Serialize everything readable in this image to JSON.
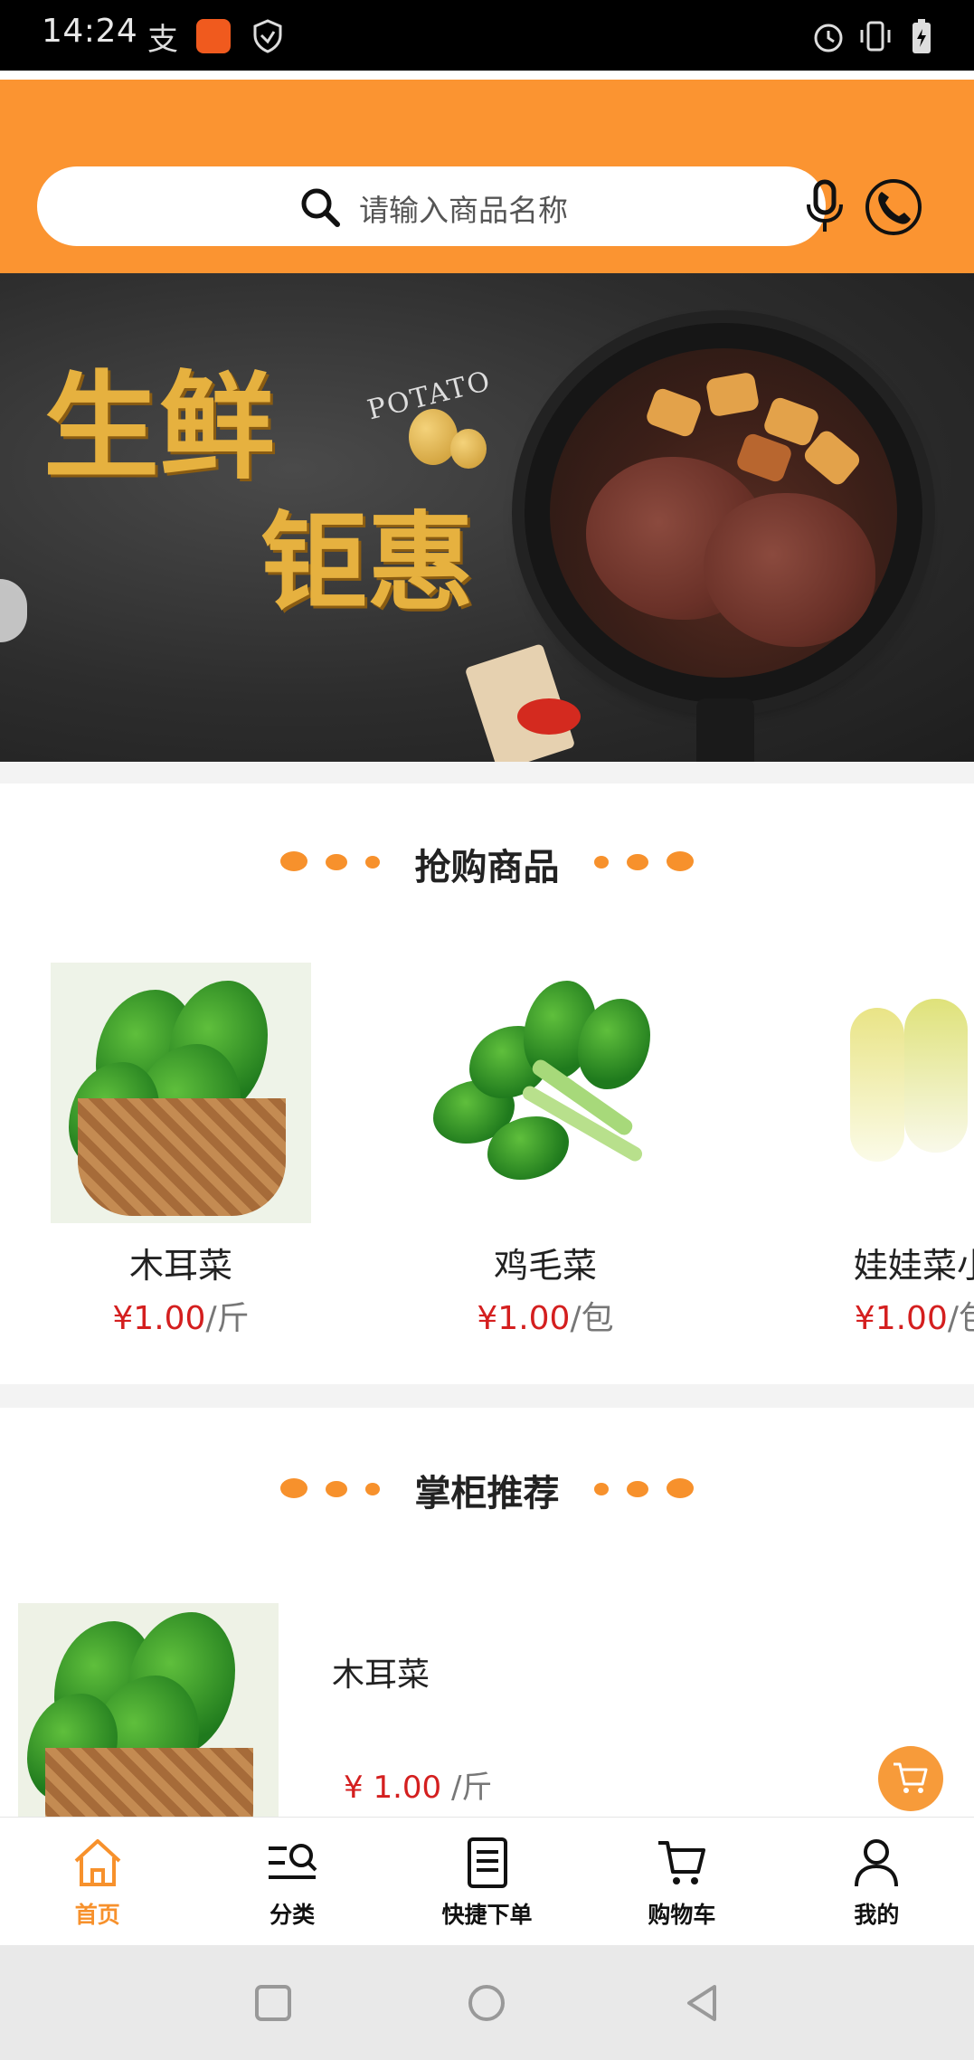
{
  "status_bar": {
    "time": "14:24",
    "icons": [
      "alipay-icon",
      "app-badge-icon",
      "shield-icon",
      "alarm-icon",
      "vibrate-icon",
      "battery-charging-icon"
    ]
  },
  "header": {
    "search_placeholder": "请输入商品名称",
    "search_icon": "search-icon",
    "mic_icon": "microphone-icon",
    "phone_icon": "phone-icon",
    "accent_color": "#fb9431"
  },
  "banner": {
    "title_line1": "生鲜",
    "title_line2": "钜惠",
    "sub_label": "POTATO"
  },
  "flash_sale": {
    "title": "抢购商品",
    "items": [
      {
        "name": "木耳菜",
        "price": "¥1.00",
        "unit": "/斤"
      },
      {
        "name": "鸡毛菜",
        "price": "¥1.00",
        "unit": "/包"
      },
      {
        "name": "娃娃菜小",
        "price": "¥1.00",
        "unit": "/包"
      }
    ]
  },
  "recommend": {
    "title": "掌柜推荐",
    "items": [
      {
        "name": "木耳菜",
        "price": "¥ 1.00",
        "unit": "/斤"
      }
    ]
  },
  "bottom_nav": {
    "items": [
      {
        "label": "首页",
        "icon": "home-icon",
        "active": true
      },
      {
        "label": "分类",
        "icon": "category-search-icon",
        "active": false
      },
      {
        "label": "快捷下单",
        "icon": "quick-order-icon",
        "active": false
      },
      {
        "label": "购物车",
        "icon": "cart-icon",
        "active": false
      },
      {
        "label": "我的",
        "icon": "user-icon",
        "active": false
      }
    ]
  },
  "colors": {
    "accent": "#f7912c",
    "price": "#d41f1f"
  }
}
